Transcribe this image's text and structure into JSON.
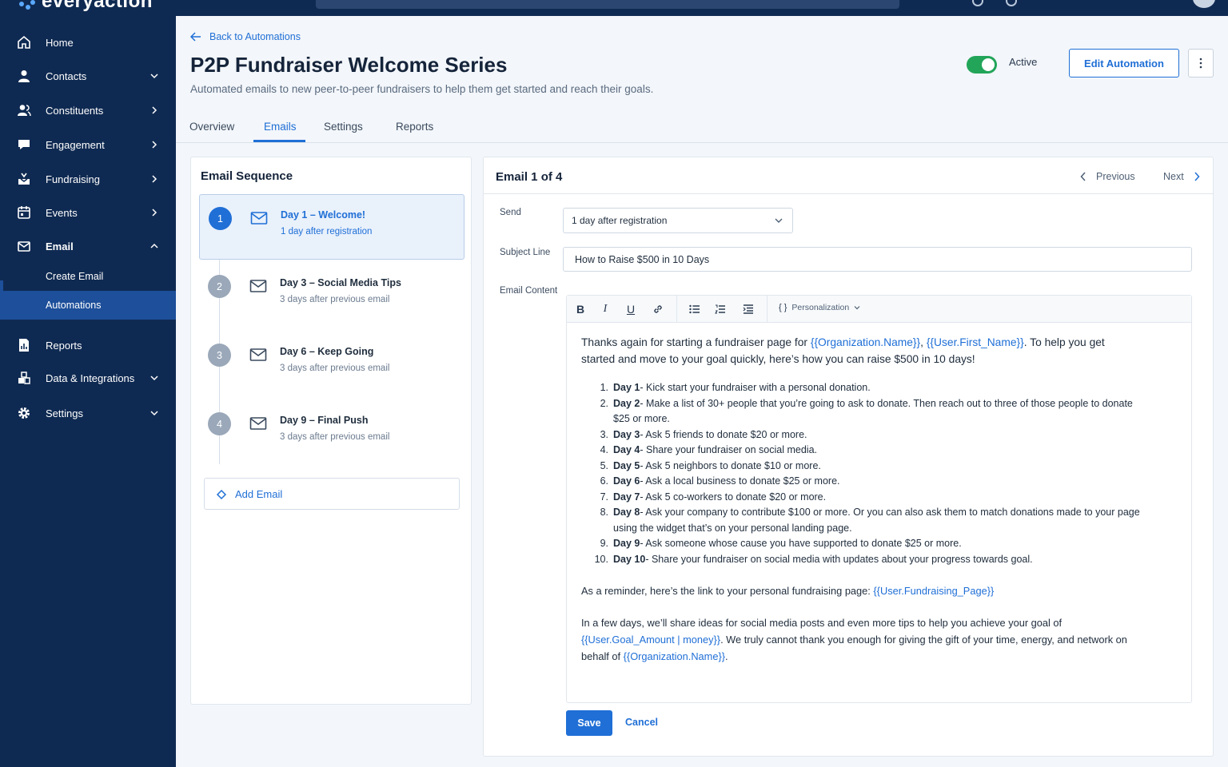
{
  "app": {
    "brand": "everyaction"
  },
  "sidebar": {
    "items": [
      {
        "label": "Home",
        "icon": "home-icon"
      },
      {
        "label": "Contacts",
        "icon": "person-icon"
      },
      {
        "label": "Constituents",
        "icon": "people-icon"
      },
      {
        "label": "Engagement",
        "icon": "chat-icon"
      },
      {
        "label": "Fundraising",
        "icon": "donation-icon"
      },
      {
        "label": "Events",
        "icon": "calendar-icon"
      },
      {
        "label": "Email",
        "icon": "mail-icon"
      },
      {
        "label": "Reports",
        "icon": "report-icon"
      },
      {
        "label": "Data & Integrations",
        "icon": "database-icon"
      },
      {
        "label": "Settings",
        "icon": "gear-icon"
      }
    ],
    "email_sub": [
      {
        "label": "Create Email"
      },
      {
        "label": "Automations"
      }
    ]
  },
  "header": {
    "back_label": "Back to Automations",
    "title": "P2P Fundraiser Welcome Series",
    "subtitle": "Automated emails to new peer-to-peer fundraisers to help them get started and reach their goals.",
    "status_label": "Active",
    "status_active": true,
    "edit_label": "Edit Automation"
  },
  "tabs": [
    {
      "label": "Overview"
    },
    {
      "label": "Emails"
    },
    {
      "label": "Settings"
    },
    {
      "label": "Reports"
    }
  ],
  "sequence": {
    "title": "Email Sequence",
    "items": [
      {
        "num": "1",
        "title": "Day 1 – Welcome!",
        "sub": "1 day after registration"
      },
      {
        "num": "2",
        "title": "Day 3 – Social Media Tips",
        "sub": "3 days after previous email"
      },
      {
        "num": "3",
        "title": "Day 6 – Keep Going",
        "sub": "3 days after previous email"
      },
      {
        "num": "4",
        "title": "Day 9 – Final Push",
        "sub": "3 days after previous email"
      }
    ],
    "add_label": "Add Email"
  },
  "email": {
    "title": "Email 1 of 4",
    "prev_label": "Previous",
    "next_label": "Next",
    "send_label": "Send",
    "send_value": "1 day after registration",
    "subject_label": "Subject Line",
    "subject_value": "How to Raise $500 in 10 Days",
    "content_label": "Email Content",
    "personalization_label": "Personalization",
    "body": {
      "intro_a": "Thanks again for starting a fundraiser page for ",
      "tok_org": "{{Organization.Name}}",
      "comma": ", ",
      "tok_first": "{{User.First_Name}}",
      "intro_b": ". To help you get started and move to your goal quickly, here’s how you can raise $500 in 10 days!",
      "steps": [
        {
          "n": "1.",
          "day": "Day 1",
          "text": "- Kick start your fundraiser with a personal donation."
        },
        {
          "n": "2.",
          "day": "Day 2",
          "text": "- Make a list of 30+ people that you’re going to ask to donate. Then reach out to three of those people to donate $25 or more."
        },
        {
          "n": "3.",
          "day": "Day 3",
          "text": "- Ask 5 friends to donate $20 or more."
        },
        {
          "n": "4.",
          "day": "Day 4",
          "text": "- Share your fundraiser on social media."
        },
        {
          "n": "5.",
          "day": "Day 5",
          "text": "- Ask 5 neighbors to donate $10 or more."
        },
        {
          "n": "6.",
          "day": "Day 6",
          "text": "- Ask a local business to donate $25 or more."
        },
        {
          "n": "7.",
          "day": "Day 7",
          "text": "- Ask 5 co-workers to donate $20 or more."
        },
        {
          "n": "8.",
          "day": "Day 8",
          "text": "- Ask your company to contribute $100 or more. Or you can also ask them to match donations made to your page using the widget that’s on your personal landing page."
        },
        {
          "n": "9.",
          "day": "Day 9",
          "text": "- Ask someone whose cause you have supported to donate $25 or more."
        },
        {
          "n": "10.",
          "day": "Day 10",
          "text": "- Share your fundraiser on social media with updates about your progress towards goal."
        }
      ],
      "reminder": "As a reminder, here’s the link to your personal fundraising page: ",
      "tok_page": "{{User.Fundraising_Page}}",
      "closing_a": "In a few days, we’ll share ideas for social media posts and even more tips to help you achieve your goal of ",
      "tok_goal": "{{User.Goal_Amount | money}}",
      "closing_b": ". We truly cannot thank you enough for giving the gift of your time, energy, and network on behalf of ",
      "tok_org2": "{{Organization.Name}}",
      "closing_c": "."
    },
    "save_label": "Save",
    "cancel_label": "Cancel"
  },
  "colors": {
    "sidebar": "#0f2a52",
    "accent": "#1f6fd6",
    "active_toggle": "#22a559"
  }
}
